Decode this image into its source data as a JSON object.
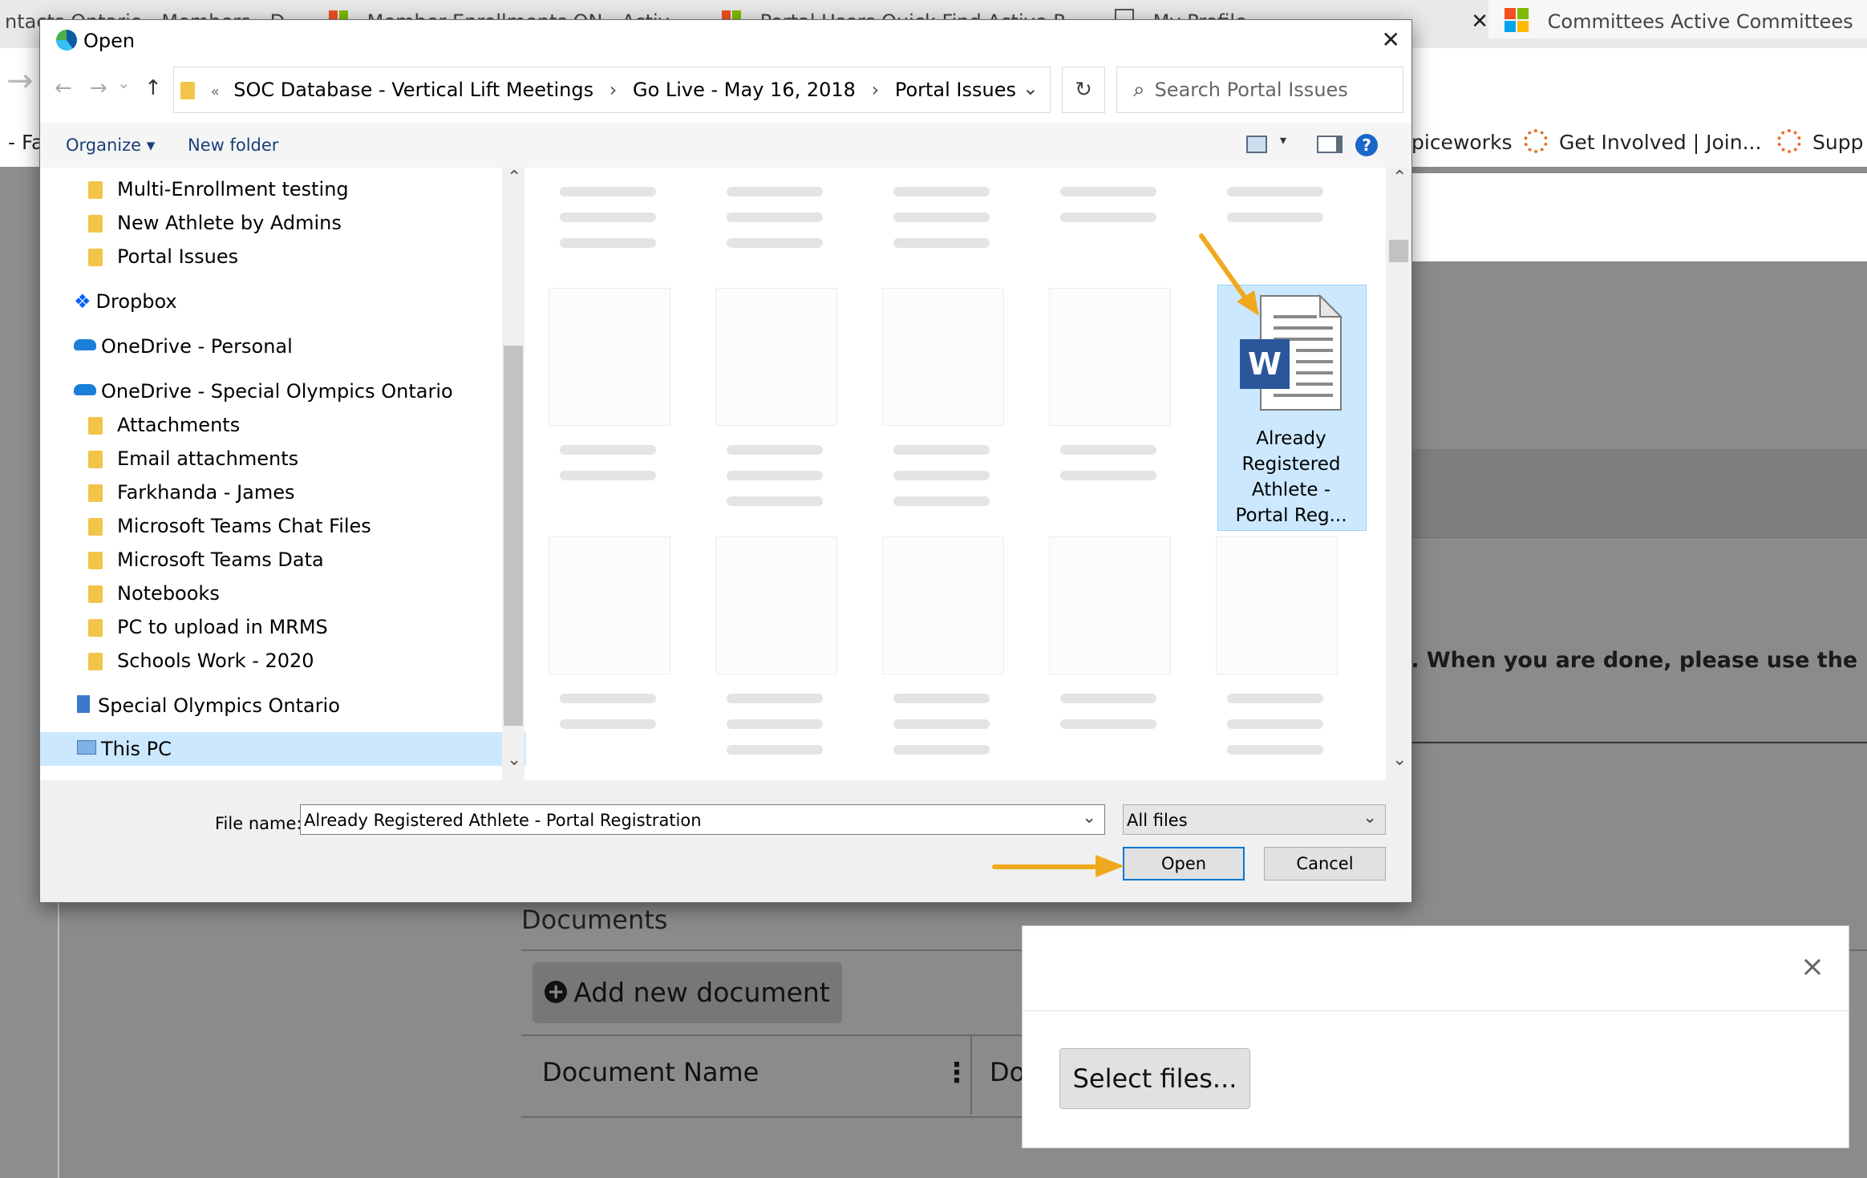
{
  "browser": {
    "tabs": [
      {
        "label": "ntacts Ontario - Members - D"
      },
      {
        "label": "Member Enrollments ON - Activ"
      },
      {
        "label": "Portal Users Quick Find Active P"
      },
      {
        "label": "My Profile"
      },
      {
        "label": "Committees Active Committees"
      }
    ],
    "bookmarks": {
      "left_label": "- Fa",
      "item1": "piceworks",
      "item2": "Get Involved | Join...",
      "item3": "Supp"
    }
  },
  "page": {
    "instruction": "n. When you are done, please use the \"Subm",
    "documents_title": "Documents",
    "add_document": "Add new document",
    "add_icon": "+",
    "columns": {
      "name": "Document Name",
      "second": "Do"
    },
    "kebab_icon": "⋮",
    "modal": {
      "select_files": "Select files...",
      "close_icon": "×"
    }
  },
  "dialog": {
    "title": "Open",
    "close_icon": "✕",
    "nav_icons": {
      "back": "←",
      "forward": "→",
      "down": "⌄",
      "up": "↑"
    },
    "breadcrumb": {
      "chevrons": "«",
      "parts": [
        "SOC Database - Vertical Lift Meetings",
        "Go Live - May 16, 2018",
        "Portal Issues"
      ],
      "separator": "›",
      "dropdown": "⌄"
    },
    "refresh_icon": "↻",
    "search": {
      "icon": "⌕",
      "placeholder": "Search Portal Issues"
    },
    "toolbar": {
      "organize": "Organize ▾",
      "new_folder": "New folder",
      "view_arrow": "▾",
      "help": "?"
    },
    "nav_items": [
      {
        "label": "Multi-Enrollment testing"
      },
      {
        "label": "New Athlete by Admins"
      },
      {
        "label": "Portal Issues"
      },
      {
        "label": "Dropbox"
      },
      {
        "label": "OneDrive - Personal"
      },
      {
        "label": "OneDrive - Special Olympics Ontario"
      },
      {
        "label": "Attachments"
      },
      {
        "label": "Email attachments"
      },
      {
        "label": "Farkhanda - James"
      },
      {
        "label": "Microsoft Teams Chat Files"
      },
      {
        "label": "Microsoft Teams Data"
      },
      {
        "label": "Notebooks"
      },
      {
        "label": "PC to upload in MRMS"
      },
      {
        "label": "Schools Work - 2020"
      },
      {
        "label": "Special Olympics Ontario"
      },
      {
        "label": "This PC"
      }
    ],
    "selected_file": {
      "line1": "Already",
      "line2": "Registered",
      "line3": "Athlete -",
      "line4": "Portal Reg...",
      "icon_letter": "W"
    },
    "file_name_label": "File name:",
    "file_name_value": "Already Registered Athlete - Portal Registration",
    "file_type": "All files",
    "open_button": "Open",
    "cancel_button": "Cancel",
    "scroll_up": "⌃",
    "scroll_down": "⌄",
    "combo_arrow": "⌄"
  },
  "colors": {
    "selection": "#cce8ff",
    "accent": "#0078d7",
    "annotation_arrow": "#f0a91f",
    "folder": "#f3c44a"
  }
}
